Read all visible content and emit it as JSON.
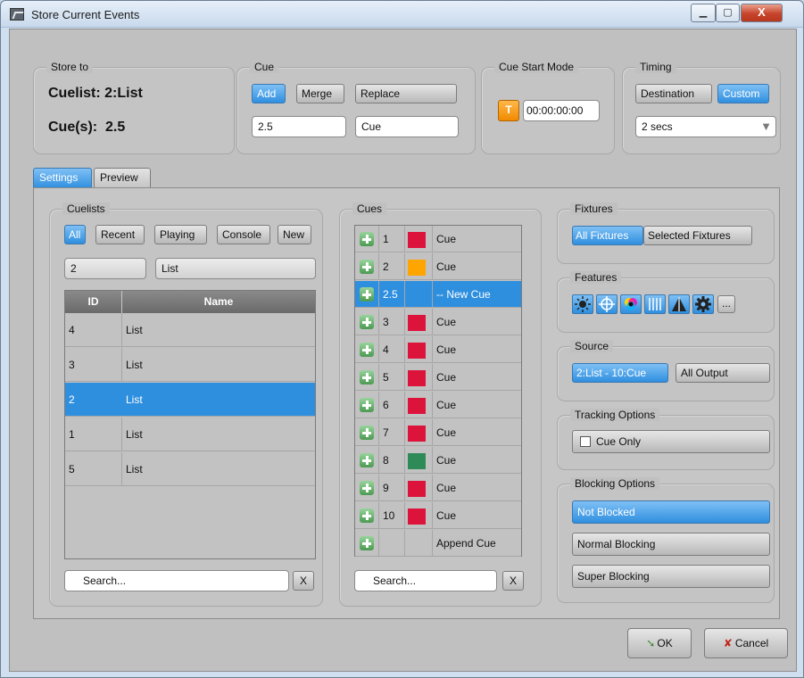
{
  "window": {
    "title": "Store Current Events",
    "minimize": "▁",
    "maximize": "▢",
    "close": "X"
  },
  "store_to": {
    "legend": "Store to",
    "cuelist": "Cuelist: 2:List",
    "cues": "Cue(s):  2.5"
  },
  "cue": {
    "legend": "Cue",
    "add": "Add",
    "merge": "Merge",
    "replace": "Replace",
    "number": "2.5",
    "name": "Cue"
  },
  "cue_start_mode": {
    "legend": "Cue Start Mode",
    "mode_label": "T",
    "time": "00:00:00:00"
  },
  "timing": {
    "legend": "Timing",
    "destination": "Destination",
    "custom": "Custom",
    "value": "2 secs"
  },
  "tabs": {
    "settings": "Settings",
    "preview": "Preview"
  },
  "cuelists": {
    "legend": "Cuelists",
    "filters": [
      "All",
      "Recent",
      "Playing",
      "Console",
      "New"
    ],
    "selected_id": "2",
    "selected_name": "List",
    "columns": [
      "ID",
      "Name"
    ],
    "rows": [
      {
        "id": "4",
        "name": "List"
      },
      {
        "id": "3",
        "name": "List"
      },
      {
        "id": "2",
        "name": "List"
      },
      {
        "id": "1",
        "name": "List"
      },
      {
        "id": "5",
        "name": "List"
      }
    ],
    "search_placeholder": "Search...",
    "clear": "X"
  },
  "cues": {
    "legend": "Cues",
    "rows": [
      {
        "number": "1",
        "color": "#dc143c",
        "name": "Cue"
      },
      {
        "number": "2",
        "color": "#ffa500",
        "name": "Cue"
      },
      {
        "number": "2.5",
        "color": "",
        "name": "-- New Cue"
      },
      {
        "number": "3",
        "color": "#dc143c",
        "name": "Cue"
      },
      {
        "number": "4",
        "color": "#dc143c",
        "name": "Cue"
      },
      {
        "number": "5",
        "color": "#dc143c",
        "name": "Cue"
      },
      {
        "number": "6",
        "color": "#dc143c",
        "name": "Cue"
      },
      {
        "number": "7",
        "color": "#dc143c",
        "name": "Cue"
      },
      {
        "number": "8",
        "color": "#2e8b57",
        "name": "Cue"
      },
      {
        "number": "9",
        "color": "#dc143c",
        "name": "Cue"
      },
      {
        "number": "10",
        "color": "#dc143c",
        "name": "Cue"
      },
      {
        "number": "",
        "color": "",
        "name": "Append Cue"
      }
    ],
    "search_placeholder": "Search...",
    "clear": "X"
  },
  "fixtures": {
    "legend": "Fixtures",
    "all": "All Fixtures",
    "selected": "Selected Fixtures"
  },
  "features": {
    "legend": "Features",
    "icons": [
      "intensity-icon",
      "position-icon",
      "color-icon",
      "gobo-icon",
      "beam-icon",
      "gear-icon"
    ],
    "more": "..."
  },
  "source": {
    "legend": "Source",
    "current": "2:List - 10:Cue",
    "all_output": "All Output"
  },
  "tracking": {
    "legend": "Tracking Options",
    "cue_only": "Cue Only"
  },
  "blocking": {
    "legend": "Blocking Options",
    "not_blocked": "Not Blocked",
    "normal": "Normal Blocking",
    "super": "Super Blocking"
  },
  "footer": {
    "ok": "OK",
    "cancel": "Cancel"
  },
  "colors": {
    "accent": "#2f8fdf",
    "red": "#dc143c",
    "orange": "#ffa500",
    "green": "#2e8b57"
  }
}
